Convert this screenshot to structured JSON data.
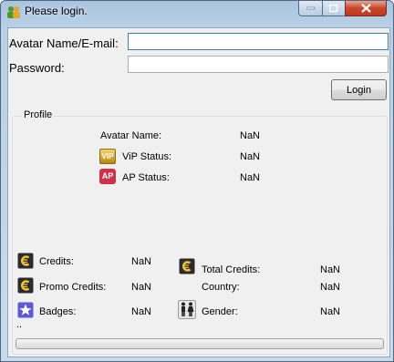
{
  "window": {
    "title": "Please login.",
    "controls": {
      "minimize": "minimize",
      "maximize": "maximize",
      "close": "close"
    }
  },
  "login": {
    "username_label": "Avatar Name/E-mail:",
    "username_value": "",
    "password_label": "Password:",
    "password_value": "",
    "login_button": "Login"
  },
  "profile": {
    "group_title": "Profile",
    "avatar_name_label": "Avatar Name:",
    "avatar_name_value": "NaN",
    "vip_status_label": "ViP Status:",
    "vip_status_value": "NaN",
    "vip_icon_text": "VIP",
    "ap_status_label": "AP Status:",
    "ap_status_value": "NaN",
    "ap_icon_text": "AP",
    "credits_label": "Credits:",
    "credits_value": "NaN",
    "total_credits_label": "Total Credits:",
    "total_credits_value": "NaN",
    "promo_credits_label": "Promo Credits:",
    "promo_credits_value": "NaN",
    "country_label": "Country:",
    "country_value": "NaN",
    "badges_label": "Badges:",
    "badges_value": "NaN",
    "gender_label": "Gender:",
    "gender_value": "NaN",
    "status_text": ".."
  },
  "progress": {
    "value": 0
  },
  "colors": {
    "title_bar": "#b9d0e6",
    "client_bg": "#f0f0f0",
    "close_button": "#c8472c",
    "vip_icon": "#c9a227",
    "ap_icon": "#d0304a",
    "credit_icon_bg": "#2b2b2b",
    "badge_icon": "#5b5bd6"
  },
  "icons": [
    "app-icon",
    "vip-icon",
    "ap-icon",
    "credits-icon",
    "total-credits-icon",
    "promo-credits-icon",
    "badges-icon",
    "gender-icon"
  ]
}
